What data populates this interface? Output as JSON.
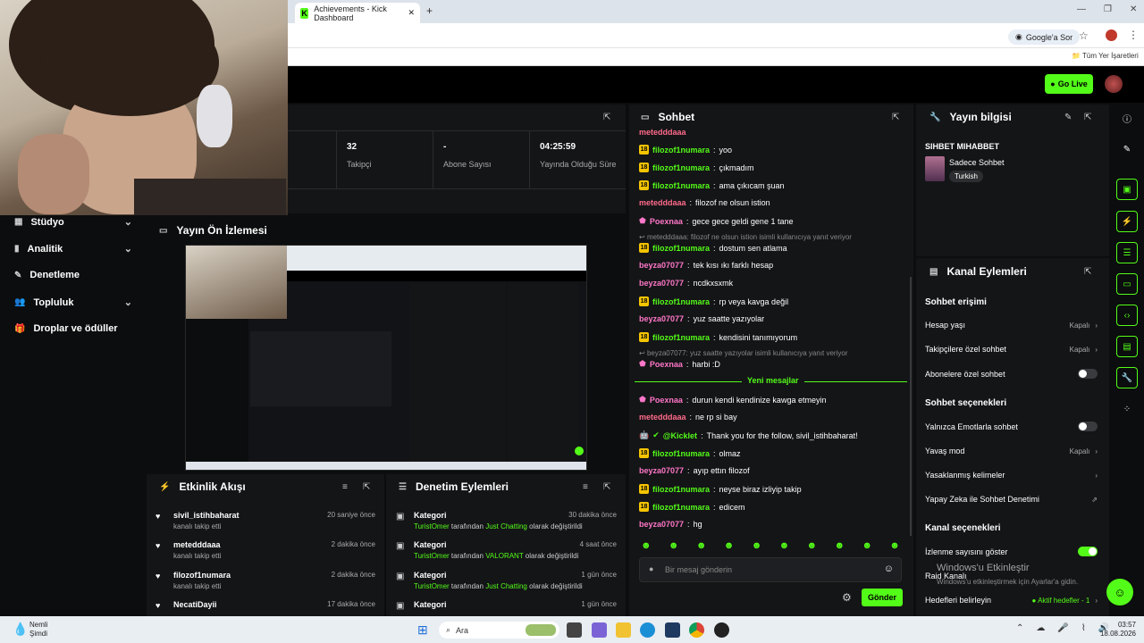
{
  "browser": {
    "tab_title": "Achievements - Kick Dashboard",
    "google_btn": "Google'a Sor",
    "bookmarks_all": "Tüm Yer İşaretleri"
  },
  "header": {
    "go_live": "Go Live"
  },
  "sidebar": {
    "items": [
      {
        "label": "Stüdyo"
      },
      {
        "label": "Analitik"
      },
      {
        "label": "Denetleme"
      },
      {
        "label": "Topluluk"
      },
      {
        "label": "Droplar ve ödüller"
      }
    ]
  },
  "stats": [
    {
      "value": "32",
      "label": "Takipçi"
    },
    {
      "value": "-",
      "label": "Abone Sayısı"
    },
    {
      "value": "04:25:59",
      "label": "Yayında Olduğu Süre"
    }
  ],
  "preview": {
    "title": "Yayın Ön İzlemesi"
  },
  "activity": {
    "title": "Etkinlik Akışı",
    "items": [
      {
        "name": "sivil_istihbaharat",
        "sub": "kanalı takip etti",
        "time": "20 saniye önce"
      },
      {
        "name": "metedddaaa",
        "sub": "kanalı takip etti",
        "time": "2 dakika önce"
      },
      {
        "name": "filozof1numara",
        "sub": "kanalı takip etti",
        "time": "2 dakika önce"
      },
      {
        "name": "NecatiDayii",
        "sub": "",
        "time": "17 dakika önce"
      }
    ]
  },
  "mod": {
    "title": "Denetim Eylemleri",
    "items": [
      {
        "name": "Kategori",
        "user": "TuristOmer",
        "mid": " tarafından ",
        "cat": "Just Chatting",
        "end": " olarak değiştirildi",
        "time": "30 dakika önce"
      },
      {
        "name": "Kategori",
        "user": "TuristOmer",
        "mid": " tarafından ",
        "cat": "VALORANT",
        "end": " olarak değiştirildi",
        "time": "4 saat önce"
      },
      {
        "name": "Kategori",
        "user": "TuristOmer",
        "mid": " tarafından ",
        "cat": "Just Chatting",
        "end": " olarak değiştirildi",
        "time": "1 gün önce"
      },
      {
        "name": "Kategori",
        "user": "",
        "mid": "",
        "cat": "",
        "end": "",
        "time": "1 gün önce"
      }
    ]
  },
  "chat": {
    "title": "Sohbet",
    "messages": [
      {
        "user": "filozof1numara",
        "text": "yoo"
      },
      {
        "user": "filozof1numara",
        "text": "çıkmadım"
      },
      {
        "user": "filozof1numara",
        "text": "ama çıkıcam şuan"
      },
      {
        "user": "metedddaaa",
        "text": "filozof ne olsun istion"
      },
      {
        "user": "Poexnaa",
        "text": "gece gece geldi gene 1 tane"
      },
      {
        "user": "filozof1numara",
        "text": "dostum sen atlama"
      },
      {
        "user": "beyza07077",
        "text": "tek kısı ıkı farklı hesap"
      },
      {
        "user": "beyza07077",
        "text": "ncdkxsxmk"
      },
      {
        "user": "filozof1numara",
        "text": "rp veya kavga değil"
      },
      {
        "user": "beyza07077",
        "text": "yuz saatte yazıyolar"
      },
      {
        "user": "filozof1numara",
        "text": "kendisini tanımıyorum"
      },
      {
        "user": "Poexnaa",
        "text": "harbi :D"
      },
      {
        "user": "Poexnaa",
        "text": "durun kendi kendinize kawga etmeyin"
      },
      {
        "user": "metedddaaa",
        "text": "ne rp si bay"
      },
      {
        "user": "@Kicklet",
        "text": "Thank you for the follow, sivil_istihbaharat!"
      },
      {
        "user": "filozof1numara",
        "text": "olmaz"
      },
      {
        "user": "beyza07077",
        "text": "ayıp ettın filozof"
      },
      {
        "user": "filozof1numara",
        "text": "neyse biraz izliyip takip"
      },
      {
        "user": "filozof1numara",
        "text": "edicem"
      },
      {
        "user": "beyza07077",
        "text": "hg"
      }
    ],
    "reply1": "metedddaaa: filozof ne olsun istion isimli kullanıcıya yanıt veriyor",
    "reply2": "beyza07077: yuz saatte yazıyolar isimli kullanıcıya yanıt veriyor",
    "new_messages": "Yeni mesajlar",
    "placeholder": "Bir mesaj gönderin",
    "send": "Gönder",
    "top_partial": "metedddaaa"
  },
  "stream_info": {
    "title": "Yayın bilgisi",
    "stream_name": "SIHBET MIHABBET",
    "category": "Sadece Sohbet",
    "language": "Turkish"
  },
  "channel_actions": {
    "title": "Kanal Eylemleri",
    "chat_access": "Sohbet erişimi",
    "account_age": {
      "label": "Hesap yaşı",
      "value": "Kapalı"
    },
    "followers_only": {
      "label": "Takipçilere özel sohbet",
      "value": "Kapalı"
    },
    "subs_only": {
      "label": "Abonelere özel sohbet"
    },
    "chat_options": "Sohbet seçenekleri",
    "emote_only": {
      "label": "Yalnızca Emotlarla sohbet"
    },
    "slow_mode": {
      "label": "Yavaş mod",
      "value": "Kapalı"
    },
    "banned_words": {
      "label": "Yasaklanmış kelimeler"
    },
    "ai_mod": {
      "label": "Yapay Zeka ile Sohbet Denetimi"
    },
    "channel_options": "Kanal seçenekleri",
    "show_viewers": {
      "label": "İzlenme sayısını göster"
    },
    "raid": {
      "label": "Raid Kanalı"
    },
    "goals": {
      "label": "Hedefleri belirleyin",
      "value": "Aktif hedefler - 1"
    }
  },
  "watermark": {
    "title": "Windows'u Etkinleştir",
    "sub": "Windows'u etkinleştirmek için Ayarlar'a gidin."
  },
  "taskbar": {
    "weather": "Nemli",
    "weather_sub": "Şimdi",
    "search": "Ara",
    "time": "03:57",
    "date": "18.08.2026"
  },
  "colors": {
    "accent": "#53fc18",
    "background": "#0b0d0e",
    "panel": "#141517"
  }
}
